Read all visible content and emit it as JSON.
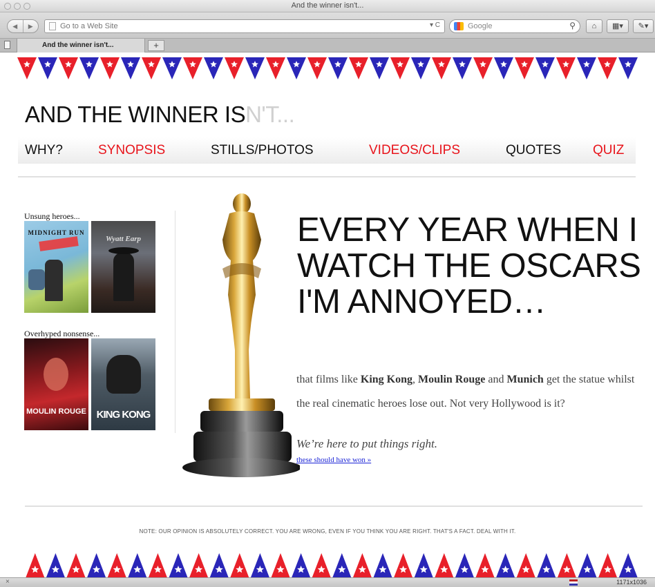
{
  "browser": {
    "window_title": "And the winner isn't...",
    "nav_back": "◀",
    "nav_forward": "▶",
    "url_placeholder": "Go to a Web Site",
    "url_controls": "▾ C",
    "search_placeholder": "Google",
    "search_icon": "search-icon",
    "tab_title": "And the winner isn't...",
    "new_tab": "+",
    "home_icon": "home-icon",
    "status_size": "1171x1036"
  },
  "site": {
    "title_main": "AND THE WINNER IS",
    "title_faded": "N'T...",
    "nav": [
      {
        "label": "WHY?",
        "color": "black"
      },
      {
        "label": "SYNOPSIS",
        "color": "red"
      },
      {
        "label": "STILLS/PHOTOS",
        "color": "black"
      },
      {
        "label": "VIDEOS/CLIPS",
        "color": "red"
      },
      {
        "label": "QUOTES",
        "color": "black"
      },
      {
        "label": "QUIZ",
        "color": "red"
      }
    ],
    "unsung_label": "Unsung heroes...",
    "overhyped_label": "Overhyped nonsense...",
    "posters": {
      "midnight_run": "MIDNIGHT RUN",
      "wyatt_earp": "Wyatt Earp",
      "moulin_rouge": "MOULIN ROUGE",
      "king_kong": "KING KONG"
    },
    "headline": "EVERY YEAR WHEN I WATCH THE OSCARS I'M ANNOYED…",
    "body": {
      "p1": "that films like ",
      "film1": "King Kong",
      "p2": ", ",
      "film2": "Moulin Rouge",
      "p3": " and ",
      "film3": "Munich",
      "p4": " get the statue whilst the real cinematic heroes lose out. Not very Hollywood is it?"
    },
    "tagline": "We’re here to put things right.",
    "won_link": "these should have won »",
    "note": "NOTE: OUR OPINION IS ABSOLUTELY CORRECT. YOU ARE WRONG, EVEN IF YOU THINK YOU ARE RIGHT. THAT'S A FACT. DEAL WITH IT."
  },
  "colors": {
    "accent_red": "#e8141b",
    "bunting_red": "#e8202a",
    "bunting_blue": "#2a26b8",
    "link_blue": "#1a23d6"
  }
}
